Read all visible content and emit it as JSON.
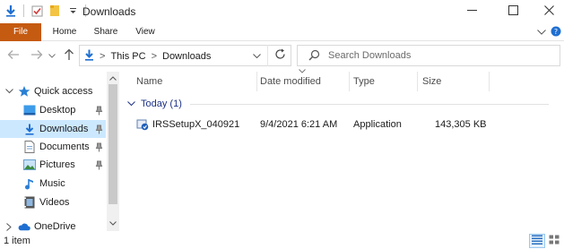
{
  "window": {
    "title": "Downloads"
  },
  "ribbon": {
    "tabs": [
      "File",
      "Home",
      "Share",
      "View"
    ],
    "accent": "#c55a11"
  },
  "address": {
    "crumbs": [
      "This PC",
      "Downloads"
    ],
    "separator": ">"
  },
  "search": {
    "placeholder": "Search Downloads"
  },
  "nav": {
    "items": [
      {
        "label": "Quick access",
        "icon": "star-icon"
      },
      {
        "label": "Desktop",
        "icon": "desktop-folder-icon"
      },
      {
        "label": "Downloads",
        "icon": "downloads-folder-icon"
      },
      {
        "label": "Documents",
        "icon": "documents-folder-icon"
      },
      {
        "label": "Pictures",
        "icon": "pictures-folder-icon"
      },
      {
        "label": "Music",
        "icon": "music-icon"
      },
      {
        "label": "Videos",
        "icon": "videos-icon"
      },
      {
        "label": "OneDrive",
        "icon": "cloud-icon"
      }
    ],
    "selected_color": "#cce8ff"
  },
  "columns": [
    "Name",
    "Date modified",
    "Type",
    "Size"
  ],
  "group": {
    "label": "Today (1)",
    "color": "#1e3287"
  },
  "files": [
    {
      "name": "IRSSetupX_040921",
      "date": "9/4/2021 6:21 AM",
      "type": "Application",
      "size": "143,305 KB",
      "icon": "application-setup-icon"
    }
  ],
  "status": {
    "count": "1 item"
  }
}
